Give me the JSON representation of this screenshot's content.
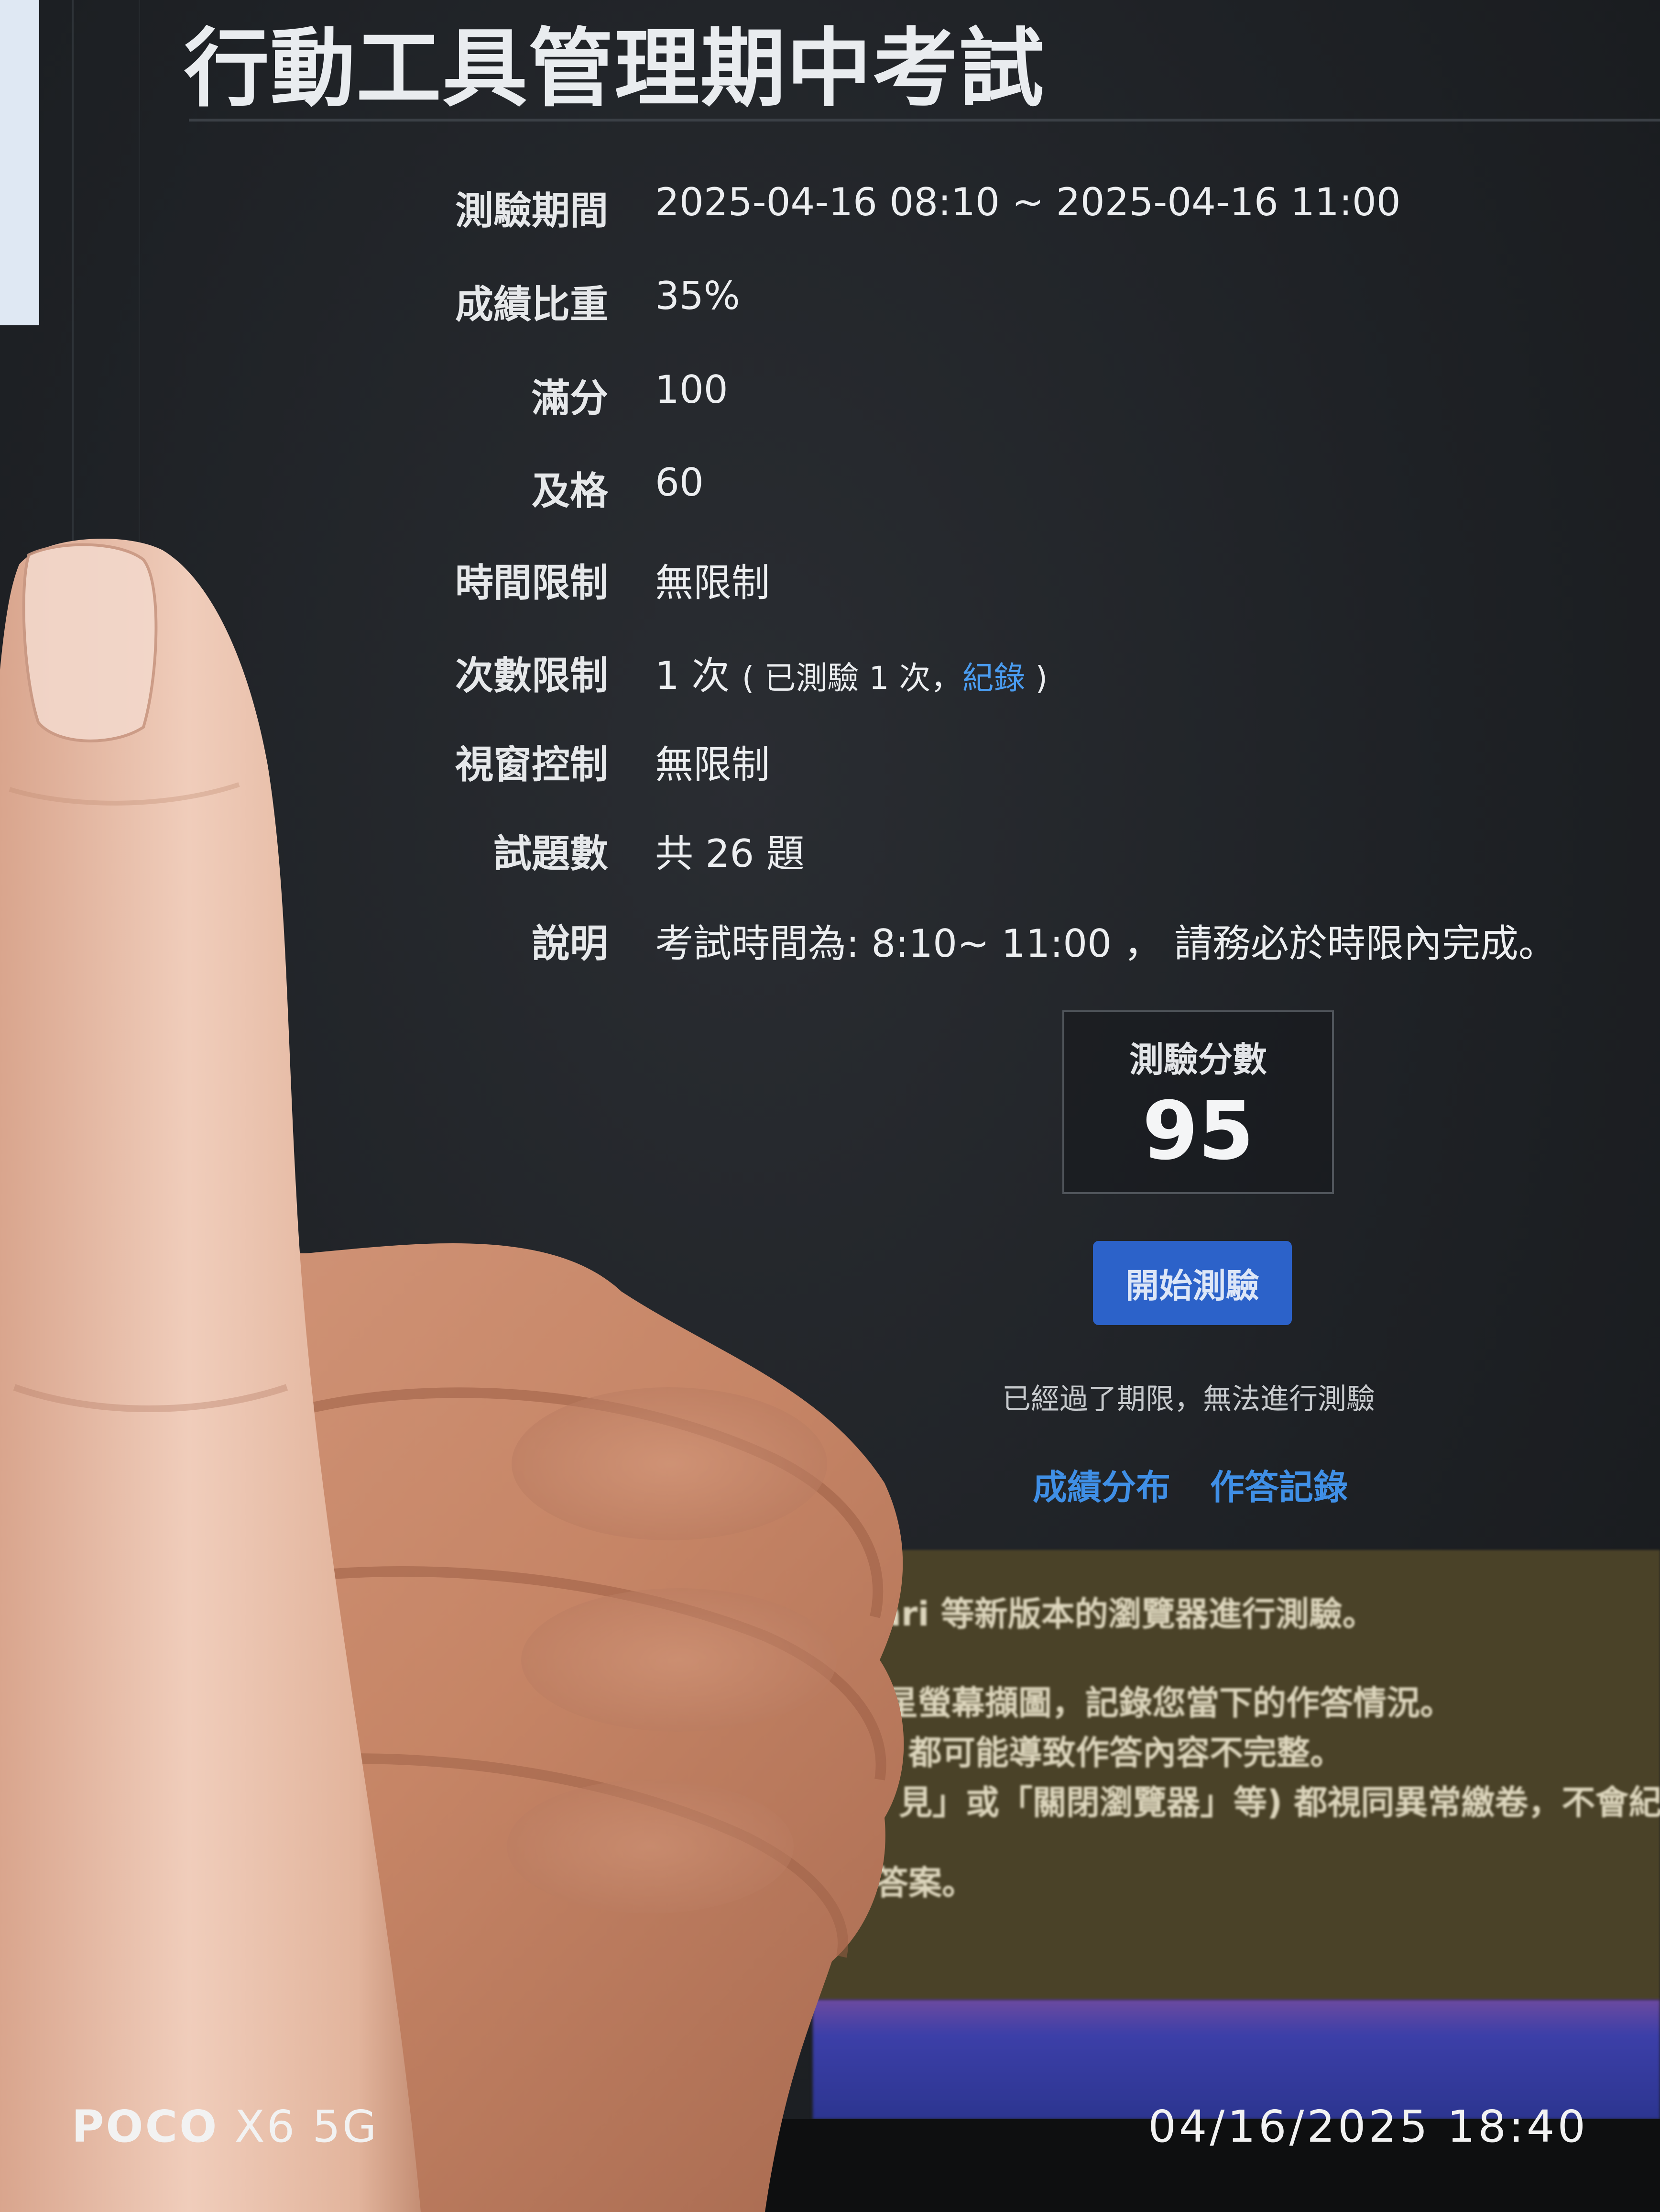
{
  "exam": {
    "title": "行動工具管理期中考試",
    "fields": [
      {
        "label": "測驗期間",
        "value": "2025-04-16 08:10 ~ 2025-04-16 11:00"
      },
      {
        "label": "成績比重",
        "value": "35%"
      },
      {
        "label": "滿分",
        "value": "100"
      },
      {
        "label": "及格",
        "value": "60"
      },
      {
        "label": "時間限制",
        "value": "無限制"
      },
      {
        "label": "次數限制",
        "value": "1 次",
        "detail_prefix": "( 已測驗 1 次，",
        "detail_link": "紀錄",
        "detail_suffix": " )"
      },
      {
        "label": "視窗控制",
        "value": "無限制"
      },
      {
        "label": "試題數",
        "value": "共 26 題"
      },
      {
        "label": "說明",
        "value": "考試時間為: 8:10~ 11:00 ， 請務必於時限內完成。"
      }
    ],
    "score_label": "測驗分數",
    "score_value": "95",
    "start_button": "開始測驗",
    "expired_note": "已經過了期限，無法進行測驗",
    "links": {
      "distribution": "成績分布",
      "records": "作答記錄"
    }
  },
  "notice": {
    "lines": [
      "afari 等新版本的瀏覽器進行測驗。",
      "星螢幕擷圖，記錄您當下的作答情況。",
      "都可能導致作答內容不完整。",
      "見」或「關閉瀏覽器」等) 都視同異常繳卷，不會紀錄",
      "的答案。"
    ]
  },
  "watermark": {
    "brand_bold": "POCO",
    "brand_model": "X6 5G",
    "datetime": "04/16/2025 18:40"
  },
  "colors": {
    "accent_button": "#2c62c9",
    "link": "#3f8fe6",
    "screen_bg": "#1e2125"
  }
}
